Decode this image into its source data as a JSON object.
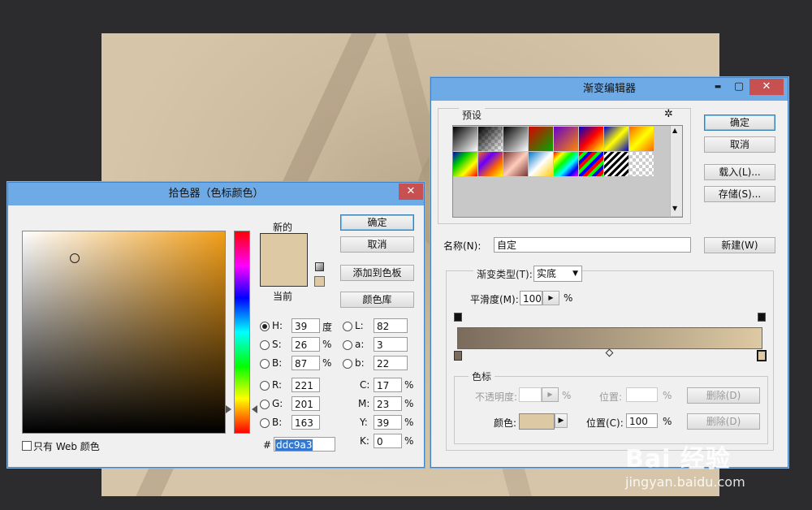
{
  "picker": {
    "title": "拾色器（色标颜色）",
    "close": "✕",
    "new_label": "新的",
    "current_label": "当前",
    "buttons": {
      "ok": "确定",
      "cancel": "取消",
      "add_swatch": "添加到色板",
      "libraries": "颜色库"
    },
    "fields": {
      "H": {
        "label": "H:",
        "value": "39",
        "unit": "度"
      },
      "S": {
        "label": "S:",
        "value": "26",
        "unit": "%"
      },
      "Bv": {
        "label": "B:",
        "value": "87",
        "unit": "%"
      },
      "R": {
        "label": "R:",
        "value": "221"
      },
      "G": {
        "label": "G:",
        "value": "201"
      },
      "Bb": {
        "label": "B:",
        "value": "163"
      },
      "L": {
        "label": "L:",
        "value": "82"
      },
      "a": {
        "label": "a:",
        "value": "3"
      },
      "b": {
        "label": "b:",
        "value": "22"
      },
      "C": {
        "label": "C:",
        "value": "17",
        "unit": "%"
      },
      "M": {
        "label": "M:",
        "value": "23",
        "unit": "%"
      },
      "Y": {
        "label": "Y:",
        "value": "39",
        "unit": "%"
      },
      "K": {
        "label": "K:",
        "value": "0",
        "unit": "%"
      }
    },
    "hex_label": "#",
    "hex_value": "ddc9a3",
    "web_only_label": "只有 Web 颜色",
    "colors": {
      "new": "#ddc9a3",
      "current": "#ddc9a3",
      "hue": "#f29e18"
    }
  },
  "gradient_editor": {
    "title": "渐变编辑器",
    "controls": {
      "minimize": "▬",
      "maximize": "▢",
      "close": "✕"
    },
    "presets_label": "预设",
    "gear": "✲",
    "buttons": {
      "ok": "确定",
      "cancel": "取消",
      "load": "载入(L)...",
      "save": "存储(S)...",
      "new": "新建(W)"
    },
    "name_label": "名称(N):",
    "name_value": "自定",
    "type_label": "渐变类型(T):",
    "type_value": "实底",
    "smooth_label": "平滑度(M):",
    "smooth_value": "100",
    "smooth_unit": "%",
    "stops_group": "色标",
    "opacity_label": "不透明度:",
    "opacity_unit": "%",
    "location_label": "位置:",
    "location_unit": "%",
    "delete_label": "删除(D)",
    "color_label": "颜色:",
    "color_location_label": "位置(C):",
    "color_location_value": "100",
    "color_location_unit": "%",
    "color_delete_label": "删除(D)",
    "gradient": {
      "start": "#7a6b5c",
      "end": "#ddc9a3"
    },
    "stop_color": "#ddc9a3"
  },
  "watermark": {
    "brand": "Bai 经验",
    "url": "jingyan.baidu.com"
  }
}
